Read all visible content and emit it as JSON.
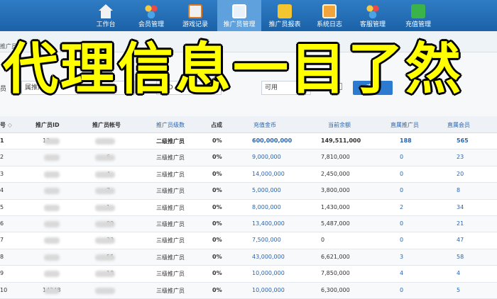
{
  "nav": {
    "items": [
      {
        "label": "工作台",
        "icon": "home-icon"
      },
      {
        "label": "会员管理",
        "icon": "users-icon"
      },
      {
        "label": "游戏记录",
        "icon": "pencil-icon"
      },
      {
        "label": "推广员管理",
        "icon": "monitor-icon",
        "active": true
      },
      {
        "label": "推广员报表",
        "icon": "money-bag-icon"
      },
      {
        "label": "系统日志",
        "icon": "notebook-icon"
      },
      {
        "label": "客服管理",
        "icon": "service-icon"
      },
      {
        "label": "充值管理",
        "icon": "recharge-icon"
      }
    ]
  },
  "subbar": {
    "crumb": "推广员"
  },
  "filter": {
    "left_label": "员",
    "input1_value": "属推广",
    "input2_value": "推ID",
    "status_value": "可用",
    "stat_label": "统计",
    "query_label": "查询"
  },
  "overlay": {
    "text": "代理信息一目了然"
  },
  "table": {
    "headers": [
      "号",
      "推广员ID",
      "推广员帐号",
      "推广员级数",
      "占成",
      "充值金币",
      "当前余额",
      "直属推广员",
      "直属会员"
    ],
    "sort_glyph": "◇",
    "rows": [
      {
        "no": "1",
        "id": "13",
        "id2": "0",
        "acct": "",
        "level": "二级推广员",
        "share": "0%",
        "gold": "600,000,000",
        "balance": "149,511,000",
        "promoters": "188",
        "members": "565"
      },
      {
        "no": "2",
        "id": "",
        "id2": "",
        "acct": "6",
        "level": "三级推广员",
        "share": "0%",
        "gold": "9,000,000",
        "balance": "7,810,000",
        "promoters": "0",
        "members": "23"
      },
      {
        "no": "3",
        "id": "",
        "id2": "",
        "acct": "4",
        "level": "三级推广员",
        "share": "0%",
        "gold": "14,000,000",
        "balance": "2,450,000",
        "promoters": "0",
        "members": "20"
      },
      {
        "no": "4",
        "id": "",
        "id2": "",
        "acct": "7",
        "level": "三级推广员",
        "share": "0%",
        "gold": "5,000,000",
        "balance": "3,800,000",
        "promoters": "0",
        "members": "8"
      },
      {
        "no": "5",
        "id": "",
        "id2": "",
        "acct": "1",
        "level": "三级推广员",
        "share": "0%",
        "gold": "8,000,000",
        "balance": "1,430,000",
        "promoters": "2",
        "members": "34"
      },
      {
        "no": "6",
        "id": "",
        "id2": "",
        "acct": "99",
        "level": "三级推广员",
        "share": "0%",
        "gold": "13,400,000",
        "balance": "5,487,000",
        "promoters": "0",
        "members": "21"
      },
      {
        "no": "7",
        "id": "",
        "id2": "",
        "acct": "33",
        "level": "三级推广员",
        "share": "0%",
        "gold": "7,500,000",
        "balance": "0",
        "promoters": "0",
        "members": "47"
      },
      {
        "no": "8",
        "id": "",
        "id2": "",
        "acct": "55",
        "level": "三级推广员",
        "share": "0%",
        "gold": "43,000,000",
        "balance": "6,621,000",
        "promoters": "3",
        "members": "58"
      },
      {
        "no": "9",
        "id": "",
        "id2": "",
        "acct": "18",
        "level": "三级推广员",
        "share": "0%",
        "gold": "10,000,000",
        "balance": "7,850,000",
        "promoters": "4",
        "members": "4"
      },
      {
        "no": "10",
        "id": "14248",
        "id2": "",
        "acct": "",
        "level": "三级推广员",
        "share": "0%",
        "gold": "10,000,000",
        "balance": "6,300,000",
        "promoters": "0",
        "members": "5"
      }
    ]
  },
  "colors": {
    "nav_bg": "#1b62a8",
    "active_tab": "#5fa1dc",
    "link_blue": "#2a64b0",
    "overlay_yellow": "#ffff00"
  }
}
